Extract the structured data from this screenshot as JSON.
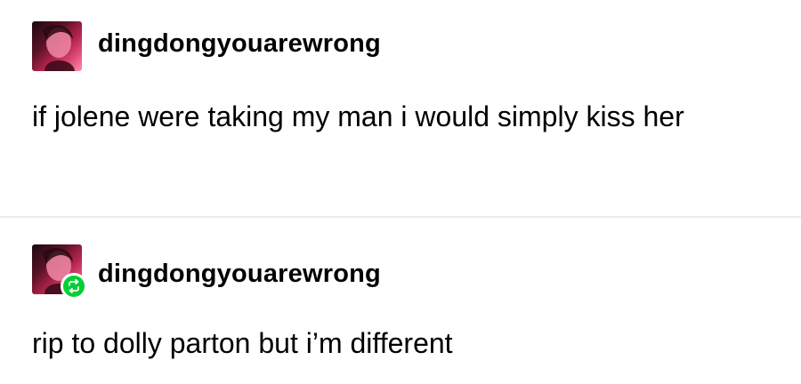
{
  "posts": [
    {
      "username": "dingdongyouarewrong",
      "text": "if jolene were taking my man i would simply kiss her",
      "avatar_icon": "user-avatar",
      "reblog": false
    },
    {
      "username": "dingdongyouarewrong",
      "text": "rip to dolly parton but i’m different",
      "avatar_icon": "user-avatar",
      "reblog": true,
      "reblog_icon": "reblog-icon",
      "reblog_color": "#00cf35"
    }
  ]
}
